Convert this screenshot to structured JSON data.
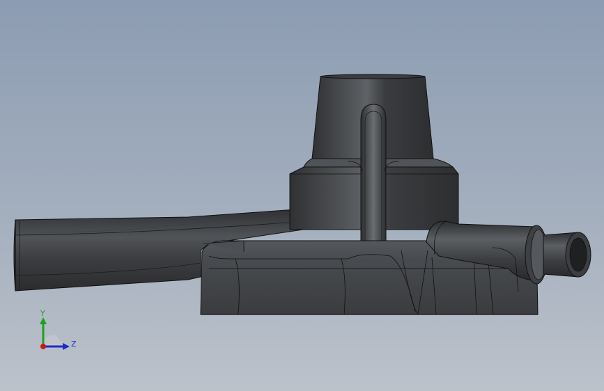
{
  "viewport": {
    "background_top": "#8c9cb2",
    "background_bottom": "#bcc2ca",
    "part_color": "#45484c"
  },
  "triad": {
    "y_label": "Y",
    "z_label": "Z",
    "y_color": "#1fa11f",
    "z_color": "#1a2fc4",
    "x_color": "#c21a1a"
  }
}
